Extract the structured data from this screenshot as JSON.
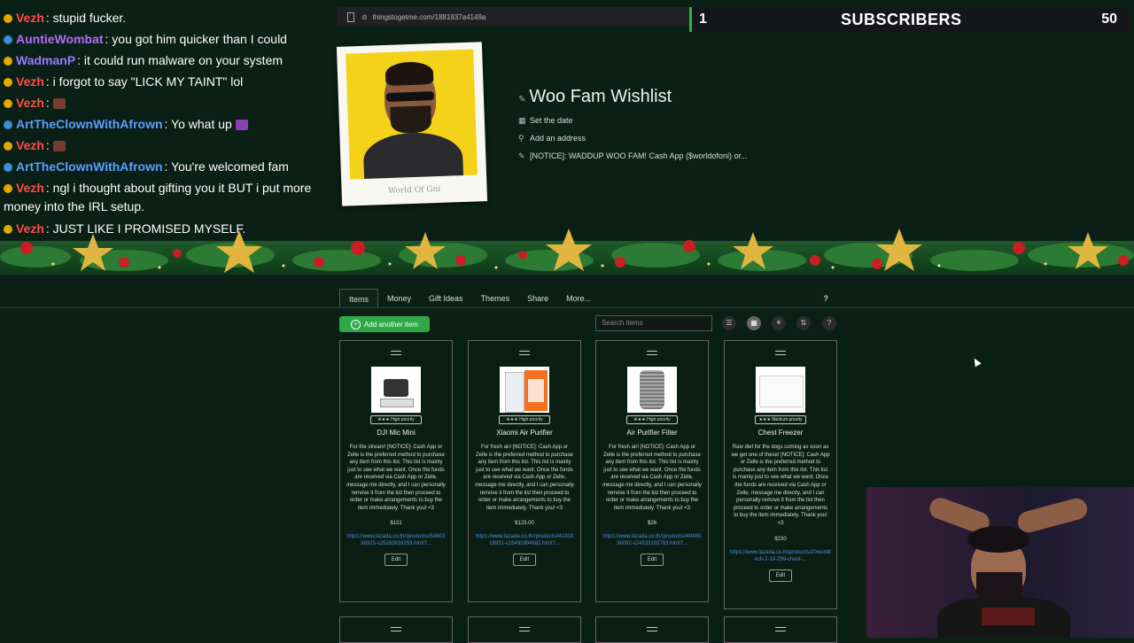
{
  "browser": {
    "url": "thingstogetme.com/1881937a4149a"
  },
  "subscriber_widget": {
    "left_count": "1",
    "label": "SUBSCRIBERS",
    "right_count": "50"
  },
  "chat": [
    {
      "user": "Vezh",
      "user_color": "#ff4d4d",
      "message": ": stupid fucker."
    },
    {
      "user": "AuntieWombat",
      "user_color": "#b46cff",
      "message": ": you got him quicker than I could"
    },
    {
      "user": "WadmanP",
      "user_color": "#9b7cff",
      "message": ": it could run malware on your system"
    },
    {
      "user": "Vezh",
      "user_color": "#ff4d4d",
      "message": ": i forgot to say \"LICK MY TAINT\" lol"
    },
    {
      "user": "Vezh",
      "user_color": "#ff4d4d",
      "message": ":"
    },
    {
      "user": "ArtTheClownWithAfrown",
      "user_color": "#5aa0ff",
      "message": ": Yo what up"
    },
    {
      "user": "Vezh",
      "user_color": "#ff4d4d",
      "message": ":"
    },
    {
      "user": "ArtTheClownWithAfrown",
      "user_color": "#5aa0ff",
      "message": ": You're welcomed fam"
    },
    {
      "user": "Vezh",
      "user_color": "#ff4d4d",
      "message": ": ngl i thought about gifting you it BUT i put more money into the IRL setup."
    },
    {
      "user": "Vezh",
      "user_color": "#ff4d4d",
      "message": ": JUST LIKE I PROMISED MYSELF."
    }
  ],
  "profile": {
    "caption": "World Of Gni"
  },
  "wishlist": {
    "title": "Woo Fam Wishlist",
    "set_date": "Set the date",
    "add_address": "Add an address",
    "notice": "[NOTICE]: WADDUP WOO FAM! Cash App ($worldofoni) or..."
  },
  "tabs": [
    "Items",
    "Money",
    "Gift Ideas",
    "Themes",
    "Share",
    "More..."
  ],
  "tabs_help": "?",
  "toolbar": {
    "add_label": "Add another item",
    "search_placeholder": "Search items",
    "help": "?"
  },
  "items": [
    {
      "priority": "★★★ High priority",
      "name": "DJI Mic Mini",
      "description": "For the stream! [NOTICE]: Cash App or Zelle is the preferred method to purchase any item from this list. This list is mainly just to see what we want. Once the funds are received via Cash App or Zelle, message me directly, and I can personally remove it from the list then proceed to order or make arrangements to buy the item immediately. Thank you! <3",
      "price": "$131",
      "link": "https://www.lazada.co.th//products/i5480338325-s25263616259.html?...",
      "edit": "Edit"
    },
    {
      "priority": "★★★ High priority",
      "name": "Xiaomi Air Purifier",
      "description": "For fresh air! [NOTICE]: Cash App or Zelle is the preferred method to purchase any item from this list. This list is mainly just to see what we want. Once the funds are received via Cash App or Zelle, message me directly, and I can personally remove it from the list then proceed to order or make arrangements to buy the item immediately. Thank you! <3",
      "price": "$123.00",
      "link": "https://www.lazada.co.th//products/i4191918931-s16491994682.html?...",
      "edit": "Edit"
    },
    {
      "priority": "★★★ High priority",
      "name": "Air Purifier Filter",
      "description": "For fresh air! [NOTICE]: Cash App or Zelle is the preferred method to purchase any item from this list. This list is mainly just to see what we want. Once the funds are received via Cash App or Zelle, message me directly, and I can personally remove it from the list then proceed to order or make arrangements to buy the item immediately. Thank you! <3",
      "price": "$28",
      "link": "https://www.lazada.co.th//products/i4948036092-s24533103783.html?...",
      "edit": "Edit"
    },
    {
      "priority": "★★★ Medium priority",
      "name": "Chest Freezer",
      "description": "Raw diet for the dogs coming as soon as we get one of these! [NOTICE]: Cash App or Zelle is the preferred method to purchase any item from this list. This list is mainly just to see what we want. Once the funds are received via Cash App or Zelle, message me directly, and I can personally remove it from the list then proceed to order or make arrangements to buy the item immediately. Thank you! <3",
      "price": "$230",
      "link": "https://www.lazada.co.th/products/20worldtech-2-10-299-chest-...",
      "edit": "Edit"
    }
  ],
  "colors": {
    "background": "#0a1f15",
    "add_button": "#2fa84a",
    "link": "#4a8fd8",
    "photo_bg": "#f4d21a",
    "sub_widget_accent": "#29b935"
  }
}
